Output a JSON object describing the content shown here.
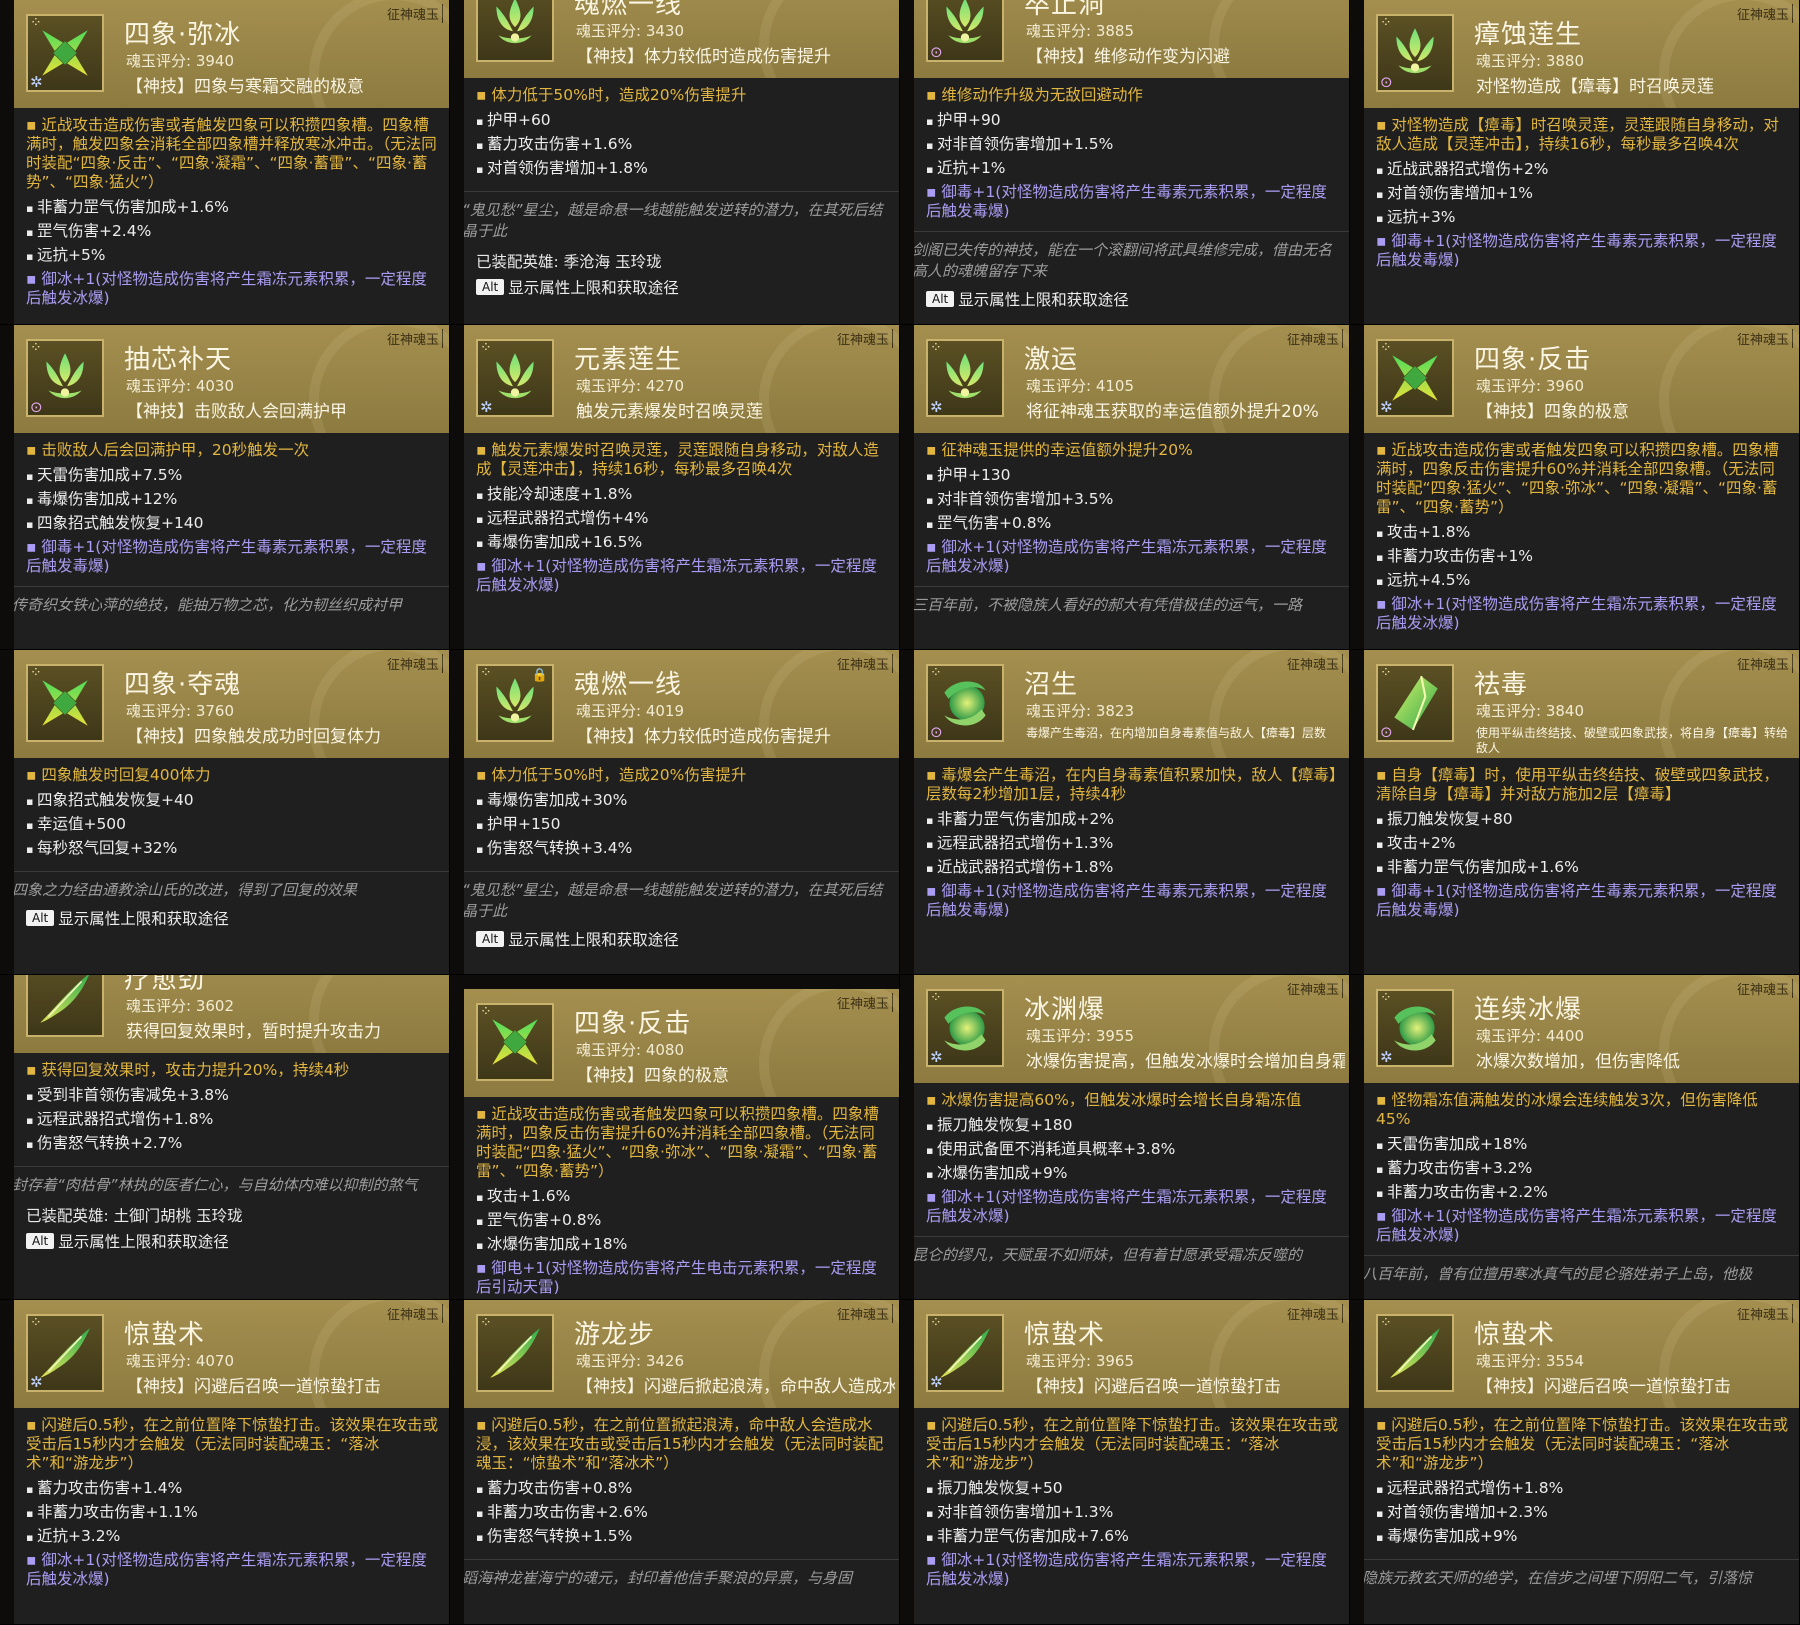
{
  "ui": {
    "tag_label": "征神魂玉",
    "alt_key": "Alt",
    "alt_text": "显示属性上限和获取途径"
  },
  "cards": [
    {
      "icon": "sixiang-knot-icon",
      "badge": "snowflake",
      "shift": "shift-0",
      "title": "四象·弥冰",
      "score": "魂玉评分: 3940",
      "skill": "【神技】四象与寒霜交融的极意",
      "lines": [
        {
          "kind": "gold",
          "text": "▪ 近战攻击造成伤害或者触发四象可以积攒四象槽。四象槽满时，触发四象会消耗全部四象槽并释放寒冰冲击。（无法同时装配“四象·反击”、“四象·凝霜”、“四象·蓄雷”、“四象·蓄势”、“四象·猛火”）"
        },
        {
          "kind": "stat",
          "text": "非蓄力罡气伤害加成+1.6%"
        },
        {
          "kind": "stat",
          "text": "罡气伤害+2.4%"
        },
        {
          "kind": "stat",
          "text": "远抗+5%"
        },
        {
          "kind": "purple",
          "text": "▪ 御冰+1(对怪物造成伤害将产生霜冻元素积累，一定程度后触发冰爆)"
        }
      ]
    },
    {
      "icon": "lotus-flame-icon",
      "badge": "",
      "shift": "shift-up",
      "title": "魂燃一线",
      "score": "魂玉评分: 3430",
      "skill": "【神技】体力较低时造成伤害提升",
      "lines": [
        {
          "kind": "gold",
          "text": "▪ 体力低于50%时，造成20%伤害提升"
        },
        {
          "kind": "stat",
          "text": "护甲+60"
        },
        {
          "kind": "stat",
          "text": "蓄力攻击伤害+1.6%"
        },
        {
          "kind": "stat",
          "text": "对首领伤害增加+1.8%"
        }
      ],
      "lore": "“鬼见愁”星尘，越是命悬一线越能触发逆转的潜力，在其死后结晶于此",
      "equip": "已装配英雄: 季沧海 玉玲珑",
      "alt": true
    },
    {
      "icon": "lotus-flame-icon",
      "badge": "pink",
      "shift": "shift-up",
      "title": "卒止洞",
      "score": "魂玉评分: 3885",
      "skill": "【神技】维修动作变为闪避",
      "lines": [
        {
          "kind": "gold",
          "text": "▪ 维修动作升级为无敌回避动作"
        },
        {
          "kind": "stat",
          "text": "护甲+90"
        },
        {
          "kind": "stat",
          "text": "对非首领伤害增加+1.5%"
        },
        {
          "kind": "stat",
          "text": "近抗+1%"
        },
        {
          "kind": "purple",
          "text": "▪ 御毒+1(对怪物造成伤害将产生毒素元素积累，一定程度后触发毒爆)"
        }
      ],
      "lore": "剑阁已失传的神技，能在一个滚翻间将武具维修完成，借由无名高人的魂魄留存下来",
      "alt": true
    },
    {
      "icon": "lotus-flame-icon",
      "badge": "pink",
      "shift": "shift-0",
      "title": "瘴蚀莲生",
      "score": "魂玉评分: 3880",
      "skill": "对怪物造成【瘴毒】时召唤灵莲",
      "lines": [
        {
          "kind": "gold",
          "text": "▪ 对怪物造成【瘴毒】时召唤灵莲，灵莲跟随自身移动，对敌人造成【灵莲冲击】，持续16秒，每秒最多召唤4次"
        },
        {
          "kind": "stat",
          "text": "近战武器招式增伤+2%"
        },
        {
          "kind": "stat",
          "text": "对首领伤害增加+1%"
        },
        {
          "kind": "stat",
          "text": "远抗+3%"
        },
        {
          "kind": "purple",
          "text": "▪ 御毒+1(对怪物造成伤害将产生毒素元素积累，一定程度后触发毒爆)"
        }
      ]
    },
    {
      "icon": "lotus-flame-icon",
      "badge": "pink",
      "shift": "shift-0",
      "title": "抽芯补天",
      "score": "魂玉评分: 4030",
      "skill": "【神技】击败敌人会回满护甲",
      "lines": [
        {
          "kind": "gold",
          "text": "▪ 击败敌人后会回满护甲，20秒触发一次"
        },
        {
          "kind": "stat",
          "text": "天雷伤害加成+7.5%"
        },
        {
          "kind": "stat",
          "text": "毒爆伤害加成+12%"
        },
        {
          "kind": "stat",
          "text": "四象招式触发恢复+140"
        },
        {
          "kind": "purple",
          "text": "▪ 御毒+1(对怪物造成伤害将产生毒素元素积累，一定程度后触发毒爆)"
        }
      ],
      "lore": "传奇织女铁心萍的绝技，能抽万物之芯，化为韧丝织成衬甲"
    },
    {
      "icon": "lotus-flame-icon",
      "badge": "snowflake",
      "shift": "shift-0",
      "title": "元素莲生",
      "score": "魂玉评分: 4270",
      "skill": "触发元素爆发时召唤灵莲",
      "lines": [
        {
          "kind": "gold",
          "text": "▪ 触发元素爆发时召唤灵莲，灵莲跟随自身移动，对敌人造成【灵莲冲击】，持续16秒，每秒最多召唤4次"
        },
        {
          "kind": "stat",
          "text": "技能冷却速度+1.8%"
        },
        {
          "kind": "stat",
          "text": "远程武器招式增伤+4%"
        },
        {
          "kind": "stat",
          "text": "毒爆伤害加成+16.5%"
        },
        {
          "kind": "purple",
          "text": "▪ 御冰+1(对怪物造成伤害将产生霜冻元素积累，一定程度后触发冰爆)"
        }
      ]
    },
    {
      "icon": "lotus-flame-icon",
      "badge": "snowflake",
      "shift": "shift-0",
      "title": "激运",
      "score": "魂玉评分: 4105",
      "skill": "将征神魂玉获取的幸运值额外提升20%",
      "lines": [
        {
          "kind": "gold",
          "text": "▪ 征神魂玉提供的幸运值额外提升20%"
        },
        {
          "kind": "stat",
          "text": "护甲+130"
        },
        {
          "kind": "stat",
          "text": "对非首领伤害增加+3.5%"
        },
        {
          "kind": "stat",
          "text": "罡气伤害+0.8%"
        },
        {
          "kind": "purple",
          "text": "▪ 御冰+1(对怪物造成伤害将产生霜冻元素积累，一定程度后触发冰爆)"
        }
      ],
      "lore": "三百年前，不被隐族人看好的郝大有凭借极佳的运气，一路"
    },
    {
      "icon": "sixiang-knot-icon",
      "badge": "snowflake",
      "shift": "shift-0",
      "title": "四象·反击",
      "score": "魂玉评分: 3960",
      "skill": "【神技】四象的极意",
      "lines": [
        {
          "kind": "gold",
          "text": "▪ 近战攻击造成伤害或者触发四象可以积攒四象槽。四象槽满时，四象反击伤害提升60%并消耗全部四象槽。（无法同时装配“四象·猛火”、“四象·弥冰”、“四象·凝霜”、“四象·蓄雷”、“四象·蓄势”）"
        },
        {
          "kind": "stat",
          "text": "攻击+1.8%"
        },
        {
          "kind": "stat",
          "text": "非蓄力攻击伤害+1%"
        },
        {
          "kind": "stat",
          "text": "远抗+4.5%"
        },
        {
          "kind": "purple",
          "text": "▪ 御冰+1(对怪物造成伤害将产生霜冻元素积累，一定程度后触发冰爆)"
        }
      ]
    },
    {
      "icon": "sixiang-knot-icon",
      "badge": "",
      "shift": "shift-0",
      "title": "四象·夺魂",
      "score": "魂玉评分: 3760",
      "skill": "【神技】四象触发成功时回复体力",
      "lines": [
        {
          "kind": "gold",
          "text": "▪ 四象触发时回复400体力"
        },
        {
          "kind": "stat",
          "text": "四象招式触发恢复+40"
        },
        {
          "kind": "stat",
          "text": "幸运值+500"
        },
        {
          "kind": "stat",
          "text": "每秒怒气回复+32%"
        }
      ],
      "lore": "四象之力经由通教涂山氏的改进，得到了回复的效果",
      "alt": true
    },
    {
      "icon": "lotus-flame-icon",
      "badge": "",
      "lock": true,
      "shift": "shift-0",
      "title": "魂燃一线",
      "score": "魂玉评分: 4019",
      "skill": "【神技】体力较低时造成伤害提升",
      "lines": [
        {
          "kind": "gold",
          "text": "▪ 体力低于50%时，造成20%伤害提升"
        },
        {
          "kind": "stat",
          "text": "毒爆伤害加成+30%"
        },
        {
          "kind": "stat",
          "text": "护甲+150"
        },
        {
          "kind": "stat",
          "text": "伤害怒气转换+3.4%"
        }
      ],
      "lore": "“鬼见愁”星尘，越是命悬一线越能触发逆转的潜力，在其死后结晶于此",
      "alt": true
    },
    {
      "icon": "serpent-orb-icon",
      "badge": "pink",
      "shift": "shift-0",
      "title": "沼生",
      "score": "魂玉评分: 3823",
      "skill": "毒爆产生毒沼，在内增加自身毒素值与敌人【瘴毒】层数",
      "skill_small": true,
      "lines": [
        {
          "kind": "gold",
          "text": "▪ 毒爆会产生毒沼，在内自身毒素值积累加快，敌人【瘴毒】层数每2秒增加1层，持续4秒"
        },
        {
          "kind": "stat",
          "text": "非蓄力罡气伤害加成+2%"
        },
        {
          "kind": "stat",
          "text": "远程武器招式增伤+1.3%"
        },
        {
          "kind": "stat",
          "text": "近战武器招式增伤+1.8%"
        },
        {
          "kind": "purple",
          "text": "▪ 御毒+1(对怪物造成伤害将产生毒素元素积累，一定程度后触发毒爆)"
        }
      ]
    },
    {
      "icon": "jade-shard-icon",
      "badge": "pink",
      "shift": "shift-0",
      "title": "祛毒",
      "score": "魂玉评分: 3840",
      "skill": "使用平纵击终结技、破壁或四象武技，将自身【瘴毒】转给敌人",
      "skill_small": true,
      "lines": [
        {
          "kind": "gold",
          "text": "▪ 自身【瘴毒】时，使用平纵击终结技、破壁或四象武技，清除自身【瘴毒】并对敌方施加2层【瘴毒】"
        },
        {
          "kind": "stat",
          "text": "振刀触发恢复+80"
        },
        {
          "kind": "stat",
          "text": "攻击+2%"
        },
        {
          "kind": "stat",
          "text": "非蓄力罡气伤害加成+1.6%"
        },
        {
          "kind": "purple",
          "text": "▪ 御毒+1(对怪物造成伤害将产生毒素元素积累，一定程度后触发毒爆)"
        }
      ]
    },
    {
      "icon": "feather-blade-icon",
      "badge": "",
      "shift": "shift-up",
      "title": "疗愈劲",
      "score": "魂玉评分: 3602",
      "skill": "获得回复效果时，暂时提升攻击力",
      "lines": [
        {
          "kind": "gold",
          "text": "▪ 获得回复效果时，攻击力提升20%，持续4秒"
        },
        {
          "kind": "stat",
          "text": "受到非首领伤害减免+3.8%"
        },
        {
          "kind": "stat",
          "text": "远程武器招式增伤+1.8%"
        },
        {
          "kind": "stat",
          "text": "伤害怒气转换+2.7%"
        }
      ],
      "lore": "封存着“肉枯骨”林执的医者仁心，与自幼体内难以抑制的煞气",
      "equip": "已装配英雄: 土御门胡桃 玉玲珑",
      "alt": true
    },
    {
      "icon": "sixiang-knot-icon",
      "badge": "",
      "shift": "shift-down",
      "title": "四象·反击",
      "score": "魂玉评分: 4080",
      "skill": "【神技】四象的极意",
      "lines": [
        {
          "kind": "gold",
          "text": "▪ 近战攻击造成伤害或者触发四象可以积攒四象槽。四象槽满时，四象反击伤害提升60%并消耗全部四象槽。（无法同时装配“四象·猛火”、“四象·弥冰”、“四象·凝霜”、“四象·蓄雷”、“四象·蓄势”）"
        },
        {
          "kind": "stat",
          "text": "攻击+1.6%"
        },
        {
          "kind": "stat",
          "text": "罡气伤害+0.8%"
        },
        {
          "kind": "stat",
          "text": "冰爆伤害加成+18%"
        },
        {
          "kind": "purple",
          "text": "▪ 御电+1(对怪物造成伤害将产生电击元素积累，一定程度后引动天雷)"
        }
      ]
    },
    {
      "icon": "serpent-orb-icon",
      "badge": "snowflake",
      "shift": "shift-0",
      "title": "冰渊爆",
      "score": "魂玉评分: 3955",
      "skill": "冰爆伤害提高，但触发冰爆时会增加自身霜冻值",
      "lines": [
        {
          "kind": "gold",
          "text": "▪ 冰爆伤害提高60%，但触发冰爆时会增长自身霜冻值"
        },
        {
          "kind": "stat",
          "text": "振刀触发恢复+180"
        },
        {
          "kind": "stat",
          "text": "使用武备匣不消耗道具概率+3.8%"
        },
        {
          "kind": "stat",
          "text": "冰爆伤害加成+9%"
        },
        {
          "kind": "purple",
          "text": "▪ 御冰+1(对怪物造成伤害将产生霜冻元素积累，一定程度后触发冰爆)"
        }
      ],
      "lore": "昆仑的缪凡，天赋虽不如师妹，但有着甘愿承受霜冻反噬的"
    },
    {
      "icon": "serpent-orb-icon",
      "badge": "snowflake",
      "shift": "shift-0",
      "title": "连续冰爆",
      "score": "魂玉评分: 4400",
      "skill": "冰爆次数增加，但伤害降低",
      "lines": [
        {
          "kind": "gold",
          "text": "▪ 怪物霜冻值满触发的冰爆会连续触发3次，但伤害降低45%"
        },
        {
          "kind": "stat",
          "text": "天雷伤害加成+18%"
        },
        {
          "kind": "stat",
          "text": "蓄力攻击伤害+3.2%"
        },
        {
          "kind": "stat",
          "text": "非蓄力攻击伤害+2.2%"
        },
        {
          "kind": "purple",
          "text": "▪ 御冰+1(对怪物造成伤害将产生霜冻元素积累，一定程度后触发冰爆)"
        }
      ],
      "lore": "八百年前，曾有位擅用寒冰真气的昆仑骆姓弟子上岛，他极"
    },
    {
      "icon": "feather-blade-icon",
      "badge": "snowflake",
      "shift": "shift-0",
      "title": "惊蛰术",
      "score": "魂玉评分: 4070",
      "skill": "【神技】闪避后召唤一道惊蛰打击",
      "lines": [
        {
          "kind": "gold",
          "text": "▪ 闪避后0.5秒，在之前位置降下惊蛰打击。该效果在攻击或受击后15秒内才会触发（无法同时装配魂玉：“落冰术”和“游龙步”）"
        },
        {
          "kind": "stat",
          "text": "蓄力攻击伤害+1.4%"
        },
        {
          "kind": "stat",
          "text": "非蓄力攻击伤害+1.1%"
        },
        {
          "kind": "stat",
          "text": "近抗+3.2%"
        },
        {
          "kind": "purple",
          "text": "▪ 御冰+1(对怪物造成伤害将产生霜冻元素积累，一定程度后触发冰爆)"
        }
      ]
    },
    {
      "icon": "feather-blade-icon",
      "badge": "",
      "shift": "shift-0",
      "title": "游龙步",
      "score": "魂玉评分: 3426",
      "skill": "【神技】闪避后掀起浪涛，命中敌人造成水浸",
      "lines": [
        {
          "kind": "gold",
          "text": "▪ 闪避后0.5秒，在之前位置掀起浪涛，命中敌人会造成水浸，该效果在攻击或受击后15秒内才会触发（无法同时装配魂玉：“惊蛰术”和“落冰术”）"
        },
        {
          "kind": "stat",
          "text": "蓄力攻击伤害+0.8%"
        },
        {
          "kind": "stat",
          "text": "非蓄力攻击伤害+2.6%"
        },
        {
          "kind": "stat",
          "text": "伤害怒气转换+1.5%"
        }
      ],
      "lore": "蹈海神龙崔海宁的魂元，封印着他信手聚浪的异禀，与身固"
    },
    {
      "icon": "feather-blade-icon",
      "badge": "snowflake",
      "shift": "shift-0",
      "title": "惊蛰术",
      "score": "魂玉评分: 3965",
      "skill": "【神技】闪避后召唤一道惊蛰打击",
      "lines": [
        {
          "kind": "gold",
          "text": "▪ 闪避后0.5秒，在之前位置降下惊蛰打击。该效果在攻击或受击后15秒内才会触发（无法同时装配魂玉：“落冰术”和“游龙步”）"
        },
        {
          "kind": "stat",
          "text": "振刀触发恢复+50"
        },
        {
          "kind": "stat",
          "text": "对非首领伤害增加+1.3%"
        },
        {
          "kind": "stat",
          "text": "非蓄力罡气伤害加成+7.6%"
        },
        {
          "kind": "purple",
          "text": "▪ 御冰+1(对怪物造成伤害将产生霜冻元素积累，一定程度后触发冰爆)"
        }
      ]
    },
    {
      "icon": "feather-blade-icon",
      "badge": "",
      "shift": "shift-0",
      "title": "惊蛰术",
      "score": "魂玉评分: 3554",
      "skill": "【神技】闪避后召唤一道惊蛰打击",
      "lines": [
        {
          "kind": "gold",
          "text": "▪ 闪避后0.5秒，在之前位置降下惊蛰打击。该效果在攻击或受击后15秒内才会触发（无法同时装配魂玉：“落冰术”和“游龙步”）"
        },
        {
          "kind": "stat",
          "text": "远程武器招式增伤+1.8%"
        },
        {
          "kind": "stat",
          "text": "对首领伤害增加+2.3%"
        },
        {
          "kind": "stat",
          "text": "毒爆伤害加成+9%"
        }
      ],
      "lore": "隐族元教玄天师的绝学，在信步之间埋下阴阳二气，引落惊"
    }
  ]
}
